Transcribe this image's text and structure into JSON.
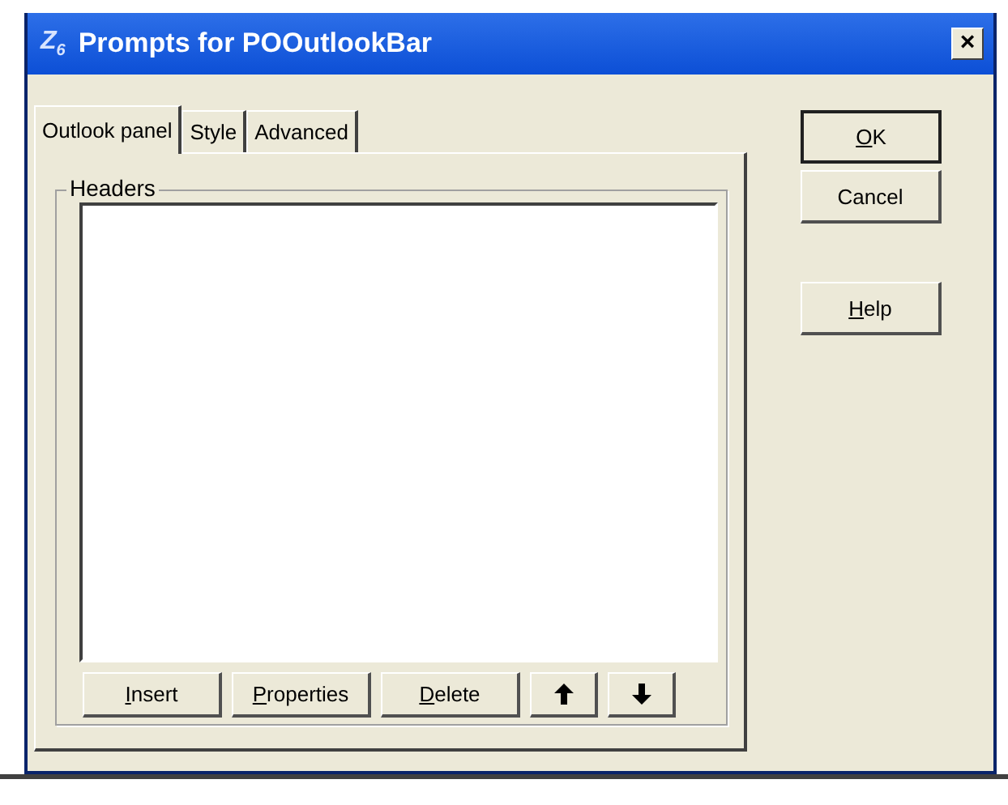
{
  "window": {
    "icon": "Z$_{6}$",
    "title": "Prompts for POOutlookBar",
    "close": "×"
  },
  "tabs": [
    {
      "label": "Outlook panel",
      "selected": true
    },
    {
      "label": "Style",
      "selected": false
    },
    {
      "label": "Advanced",
      "selected": false
    }
  ],
  "group": {
    "title": "Headers"
  },
  "list_buttons": [
    {
      "kind": "text",
      "label": "Insert",
      "mnemonic": true
    },
    {
      "kind": "text",
      "label": "Properties",
      "mnemonic": true
    },
    {
      "kind": "text",
      "label": "Delete",
      "mnemonic": true
    },
    {
      "kind": "up"
    },
    {
      "kind": "down"
    }
  ],
  "side_buttons": [
    {
      "label": "OK",
      "mnemonic": true,
      "default": true
    },
    {
      "label": "Cancel",
      "mnemonic": false,
      "default": false
    },
    {
      "label": "Help",
      "mnemonic": true,
      "default": false
    }
  ]
}
